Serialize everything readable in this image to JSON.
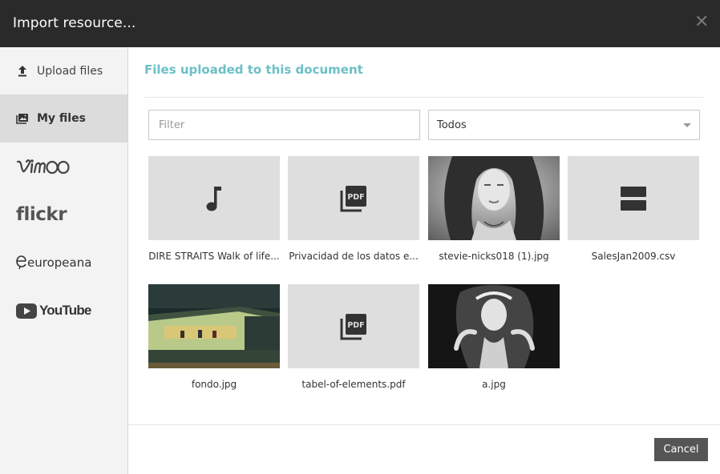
{
  "dialog": {
    "title": "Import resource...",
    "close_icon": "close-icon"
  },
  "sidebar": {
    "items": [
      {
        "label": "Upload files",
        "icon": "upload-icon"
      },
      {
        "label": "My files",
        "icon": "images-icon",
        "active": true
      },
      {
        "label": "vimeo",
        "icon": "vimeo-logo"
      },
      {
        "label": "flickr",
        "icon": "flickr-logo"
      },
      {
        "label": "europeana",
        "icon": "europeana-logo"
      },
      {
        "label": "YouTube",
        "icon": "youtube-logo"
      }
    ]
  },
  "main": {
    "section_title": "Files uploaded to this document",
    "filter_placeholder": "Filter",
    "select_value": "Todos",
    "files": [
      {
        "name": "DIRE STRAITS Walk of life...",
        "type": "audio",
        "icon": "music-note-icon"
      },
      {
        "name": "Privacidad de los datos e...",
        "type": "pdf",
        "icon": "pdf-icon"
      },
      {
        "name": "stevie-nicks018 (1).jpg",
        "type": "image",
        "icon": "image-thumbnail"
      },
      {
        "name": "SalesJan2009.csv",
        "type": "csv",
        "icon": "table-rows-icon"
      },
      {
        "name": "fondo.jpg",
        "type": "image",
        "icon": "image-thumbnail"
      },
      {
        "name": "tabel-of-elements.pdf",
        "type": "pdf",
        "icon": "pdf-icon"
      },
      {
        "name": "a.jpg",
        "type": "image",
        "icon": "image-thumbnail"
      }
    ]
  },
  "footer": {
    "cancel_label": "Cancel"
  },
  "colors": {
    "header_bg": "#2a2a2a",
    "accent_title": "#6cc0c6",
    "sidebar_bg": "#f3f3f3",
    "sidebar_active_bg": "#dcdcdc",
    "button_bg": "#555555"
  }
}
